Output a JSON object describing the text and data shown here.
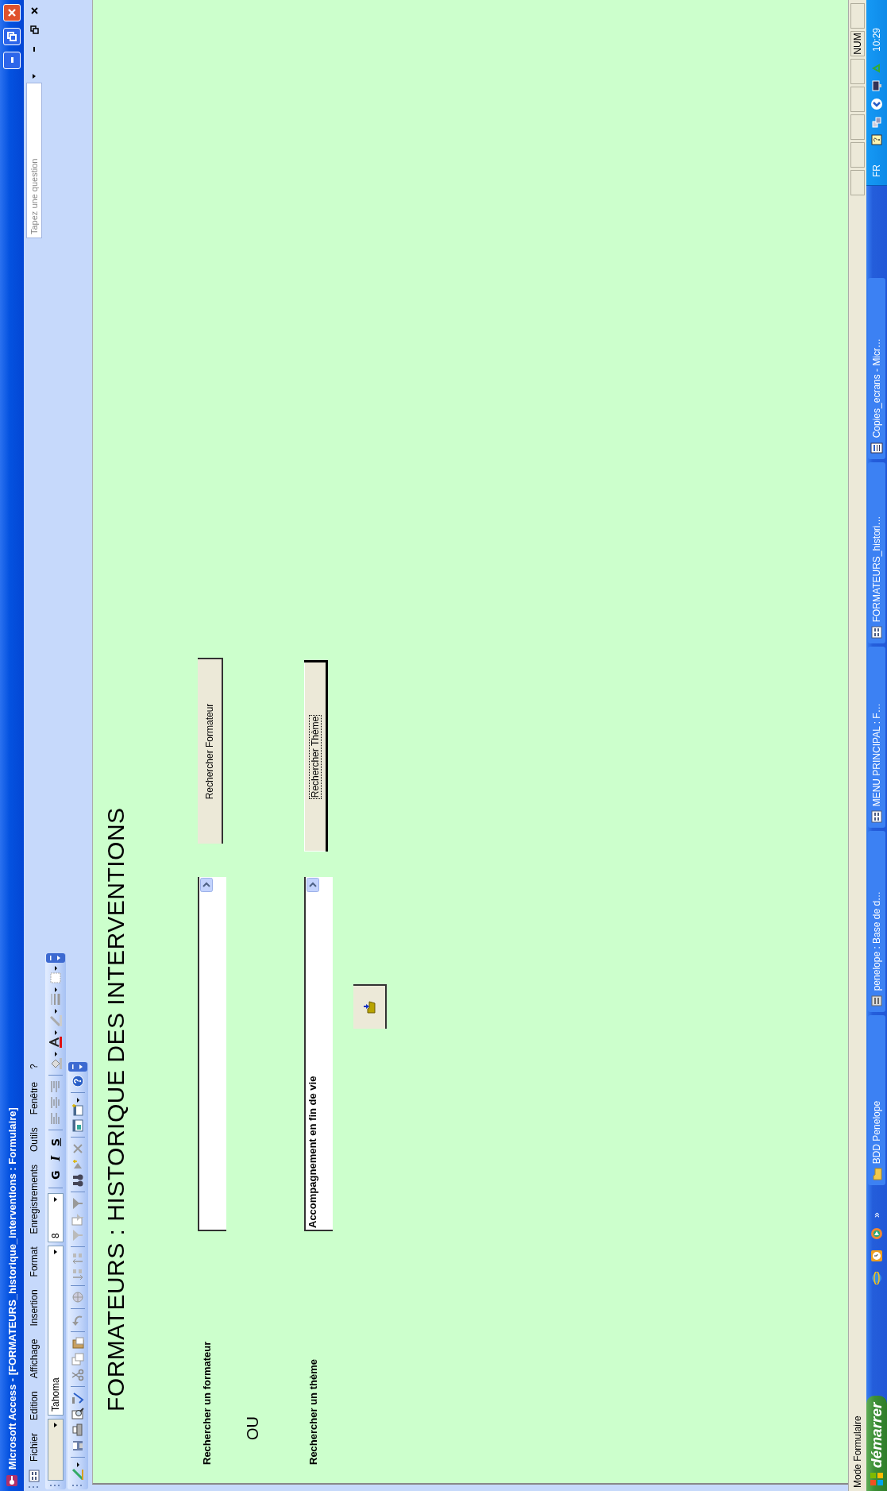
{
  "window": {
    "title": "Microsoft Access - [FORMATEURS_historique_interventions : Formulaire]"
  },
  "menu": [
    "Fichier",
    "Edition",
    "Affichage",
    "Insertion",
    "Format",
    "Enregistrements",
    "Outils",
    "Fenêtre",
    "?"
  ],
  "question_box": {
    "placeholder": "Tapez une question"
  },
  "formatting_toolbar": {
    "font": "Tahoma",
    "size": "8",
    "style_buttons": [
      {
        "label": "G",
        "kind": "bold"
      },
      {
        "label": "I",
        "kind": "italic"
      },
      {
        "label": "S",
        "kind": "underline"
      }
    ]
  },
  "form": {
    "title": "FORMATEURS : HISTORIQUE DES INTERVENTIONS",
    "searches": [
      {
        "label": "Rechercher un formateur",
        "button": "Rechercher Formateur",
        "focused": false
      },
      {
        "label": "Rechercher un thème",
        "value": "Accompagnement en fin de vie",
        "button": "Rechercher Thème",
        "focused": true
      }
    ],
    "separator": "OU"
  },
  "status_bar": {
    "mode": "Mode Formulaire",
    "indicator": "NUM"
  },
  "taskbar": {
    "start": "démarrer",
    "more": "»",
    "tasks": [
      {
        "label": "BDD Penelope",
        "kind": "folder"
      },
      {
        "label": "penelope : Base de d…",
        "kind": "database"
      },
      {
        "label": "MENU PRINCIPAL : F…",
        "kind": "form"
      },
      {
        "label": "FORMATEURS_histori…",
        "kind": "form"
      },
      {
        "label": "Copies_ecrans - Micr…",
        "kind": "word"
      }
    ],
    "language": "FR",
    "clock": "10:29"
  }
}
